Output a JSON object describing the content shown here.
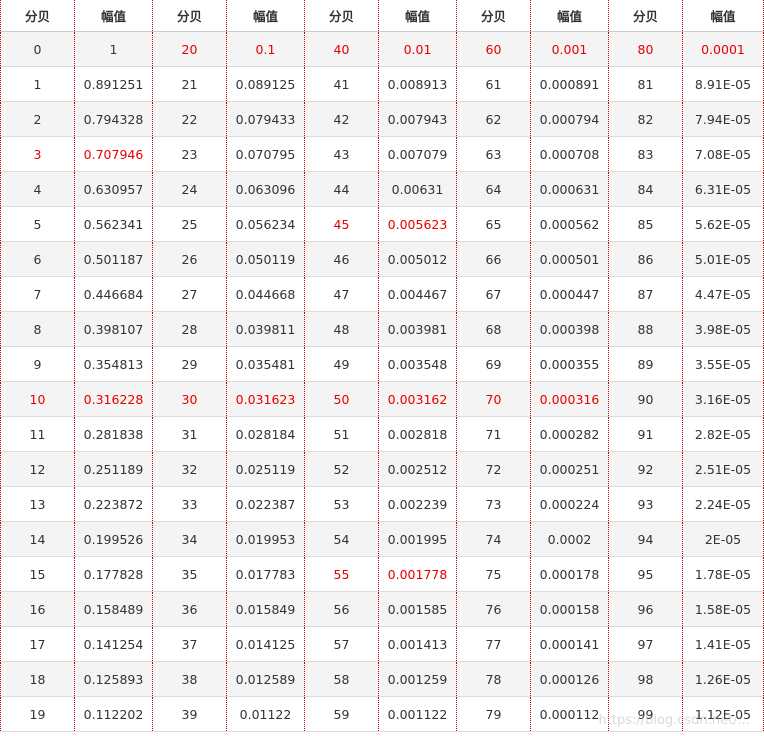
{
  "headers": [
    "分贝",
    "幅值",
    "分贝",
    "幅值",
    "分贝",
    "幅值",
    "分贝",
    "幅值",
    "分贝",
    "幅值"
  ],
  "highlight_color": "#e60000",
  "rows": [
    [
      "0",
      "1",
      "20",
      "0.1",
      "40",
      "0.01",
      "60",
      "0.001",
      "80",
      "0.0001"
    ],
    [
      "1",
      "0.891251",
      "21",
      "0.089125",
      "41",
      "0.008913",
      "61",
      "0.000891",
      "81",
      "8.91E-05"
    ],
    [
      "2",
      "0.794328",
      "22",
      "0.079433",
      "42",
      "0.007943",
      "62",
      "0.000794",
      "82",
      "7.94E-05"
    ],
    [
      "3",
      "0.707946",
      "23",
      "0.070795",
      "43",
      "0.007079",
      "63",
      "0.000708",
      "83",
      "7.08E-05"
    ],
    [
      "4",
      "0.630957",
      "24",
      "0.063096",
      "44",
      "0.00631",
      "64",
      "0.000631",
      "84",
      "6.31E-05"
    ],
    [
      "5",
      "0.562341",
      "25",
      "0.056234",
      "45",
      "0.005623",
      "65",
      "0.000562",
      "85",
      "5.62E-05"
    ],
    [
      "6",
      "0.501187",
      "26",
      "0.050119",
      "46",
      "0.005012",
      "66",
      "0.000501",
      "86",
      "5.01E-05"
    ],
    [
      "7",
      "0.446684",
      "27",
      "0.044668",
      "47",
      "0.004467",
      "67",
      "0.000447",
      "87",
      "4.47E-05"
    ],
    [
      "8",
      "0.398107",
      "28",
      "0.039811",
      "48",
      "0.003981",
      "68",
      "0.000398",
      "88",
      "3.98E-05"
    ],
    [
      "9",
      "0.354813",
      "29",
      "0.035481",
      "49",
      "0.003548",
      "69",
      "0.000355",
      "89",
      "3.55E-05"
    ],
    [
      "10",
      "0.316228",
      "30",
      "0.031623",
      "50",
      "0.003162",
      "70",
      "0.000316",
      "90",
      "3.16E-05"
    ],
    [
      "11",
      "0.281838",
      "31",
      "0.028184",
      "51",
      "0.002818",
      "71",
      "0.000282",
      "91",
      "2.82E-05"
    ],
    [
      "12",
      "0.251189",
      "32",
      "0.025119",
      "52",
      "0.002512",
      "72",
      "0.000251",
      "92",
      "2.51E-05"
    ],
    [
      "13",
      "0.223872",
      "33",
      "0.022387",
      "53",
      "0.002239",
      "73",
      "0.000224",
      "93",
      "2.24E-05"
    ],
    [
      "14",
      "0.199526",
      "34",
      "0.019953",
      "54",
      "0.001995",
      "74",
      "0.0002",
      "94",
      "2E-05"
    ],
    [
      "15",
      "0.177828",
      "35",
      "0.017783",
      "55",
      "0.001778",
      "75",
      "0.000178",
      "95",
      "1.78E-05"
    ],
    [
      "16",
      "0.158489",
      "36",
      "0.015849",
      "56",
      "0.001585",
      "76",
      "0.000158",
      "96",
      "1.58E-05"
    ],
    [
      "17",
      "0.141254",
      "37",
      "0.014125",
      "57",
      "0.001413",
      "77",
      "0.000141",
      "97",
      "1.41E-05"
    ],
    [
      "18",
      "0.125893",
      "38",
      "0.012589",
      "58",
      "0.001259",
      "78",
      "0.000126",
      "98",
      "1.26E-05"
    ],
    [
      "19",
      "0.112202",
      "39",
      "0.01122",
      "59",
      "0.001122",
      "79",
      "0.000112",
      "99",
      "1.12E-05"
    ]
  ],
  "highlighted_cells": [
    [
      0,
      2
    ],
    [
      0,
      3
    ],
    [
      0,
      4
    ],
    [
      0,
      5
    ],
    [
      0,
      6
    ],
    [
      0,
      7
    ],
    [
      0,
      8
    ],
    [
      0,
      9
    ],
    [
      3,
      0
    ],
    [
      3,
      1
    ],
    [
      5,
      4
    ],
    [
      5,
      5
    ],
    [
      10,
      0
    ],
    [
      10,
      1
    ],
    [
      10,
      2
    ],
    [
      10,
      3
    ],
    [
      10,
      4
    ],
    [
      10,
      5
    ],
    [
      10,
      6
    ],
    [
      10,
      7
    ],
    [
      15,
      4
    ],
    [
      15,
      5
    ]
  ],
  "watermark": "https://blog.csdn.net/..."
}
